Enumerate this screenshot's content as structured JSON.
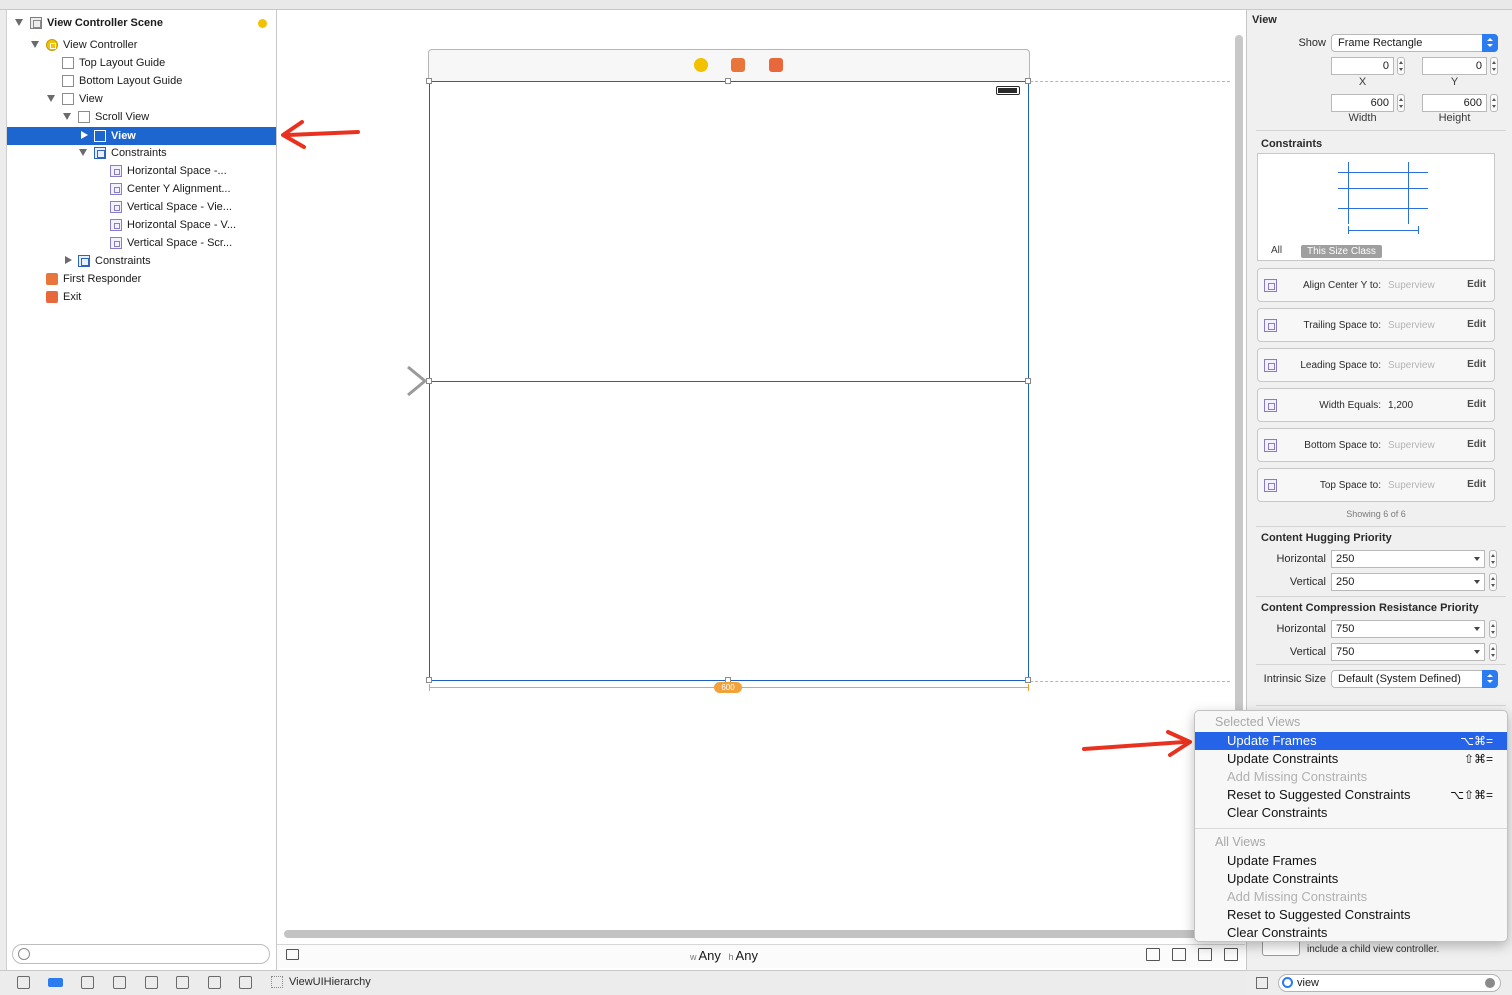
{
  "outline": {
    "scene_title": "View Controller Scene",
    "items": [
      {
        "label": "View Controller"
      },
      {
        "label": "Top Layout Guide"
      },
      {
        "label": "Bottom Layout Guide"
      },
      {
        "label": "View"
      },
      {
        "label": "Scroll View"
      },
      {
        "label": "View"
      },
      {
        "label": "Constraints"
      },
      {
        "label": "Horizontal Space -..."
      },
      {
        "label": "Center Y Alignment..."
      },
      {
        "label": "Vertical Space - Vie..."
      },
      {
        "label": "Horizontal Space - V..."
      },
      {
        "label": "Vertical Space - Scr..."
      },
      {
        "label": "Constraints"
      },
      {
        "label": "First Responder"
      },
      {
        "label": "Exit"
      }
    ]
  },
  "canvas": {
    "width_badge": "600",
    "size_class": {
      "w_prefix": "w",
      "w_value": "Any",
      "h_prefix": "h",
      "h_value": "Any"
    }
  },
  "inspector": {
    "view_heading": "View",
    "show_label": "Show",
    "show_value": "Frame Rectangle",
    "x_value": "0",
    "y_value": "0",
    "x_label": "X",
    "y_label": "Y",
    "width_value": "600",
    "height_value": "600",
    "width_label": "Width",
    "height_label": "Height",
    "constraints_heading": "Constraints",
    "tab_all": "All",
    "tab_size_class": "This Size Class",
    "constraints": [
      {
        "label": "Align Center Y to:",
        "value": "Superview",
        "edit": "Edit"
      },
      {
        "label": "Trailing Space to:",
        "value": "Superview",
        "edit": "Edit"
      },
      {
        "label": "Leading Space to:",
        "value": "Superview",
        "edit": "Edit"
      },
      {
        "label": "Width Equals:",
        "value": "1,200",
        "edit": "Edit"
      },
      {
        "label": "Bottom Space to:",
        "value": "Superview",
        "edit": "Edit"
      },
      {
        "label": "Top Space to:",
        "value": "Superview",
        "edit": "Edit"
      }
    ],
    "showing": "Showing 6 of 6",
    "hugging_heading": "Content Hugging Priority",
    "hugging_h_label": "Horizontal",
    "hugging_h_value": "250",
    "hugging_v_label": "Vertical",
    "hugging_v_value": "250",
    "compression_heading": "Content Compression Resistance Priority",
    "compression_h_label": "Horizontal",
    "compression_h_value": "750",
    "compression_v_label": "Vertical",
    "compression_v_value": "750",
    "intrinsic_label": "Intrinsic Size",
    "intrinsic_value": "Default (System Defined)",
    "library_text": "include a child view controller.",
    "library_search": "view"
  },
  "menu": {
    "selected_header": "Selected Views",
    "selected_items": [
      {
        "label": "Update Frames",
        "shortcut": "⌥⌘=",
        "state": "highlighted"
      },
      {
        "label": "Update Constraints",
        "shortcut": "⇧⌘=",
        "state": "enabled"
      },
      {
        "label": "Add Missing Constraints",
        "shortcut": "",
        "state": "disabled"
      },
      {
        "label": "Reset to Suggested Constraints",
        "shortcut": "⌥⇧⌘=",
        "state": "enabled"
      },
      {
        "label": "Clear Constraints",
        "shortcut": "",
        "state": "enabled"
      }
    ],
    "all_header": "All Views",
    "all_items": [
      {
        "label": "Update Frames",
        "state": "enabled"
      },
      {
        "label": "Update Constraints",
        "state": "enabled"
      },
      {
        "label": "Add Missing Constraints",
        "state": "disabled"
      },
      {
        "label": "Reset to Suggested Constraints",
        "state": "enabled"
      },
      {
        "label": "Clear Constraints",
        "state": "enabled"
      }
    ]
  },
  "editor_bar": {
    "hierarchy_label": "ViewUIHierarchy"
  },
  "colors": {
    "selection": "#1d66d0",
    "menu_highlight": "#2563e8",
    "annotation_arrow": "#e8321f",
    "width_rule": "#f2a23a"
  }
}
